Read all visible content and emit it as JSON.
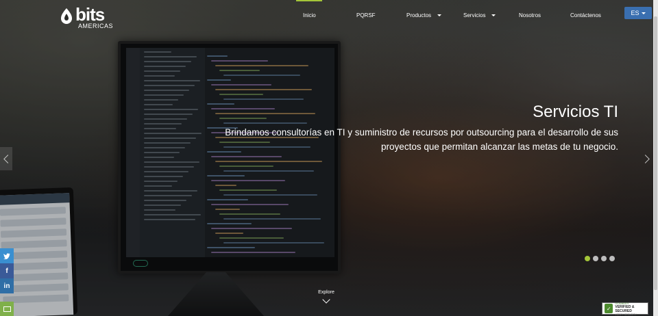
{
  "brand": {
    "name": "bits",
    "subtitle": "AMERICAS"
  },
  "nav": {
    "items": [
      {
        "label": "Inicio",
        "active": true
      },
      {
        "label": "PQRSF"
      },
      {
        "label": "Productos",
        "dropdown": true
      },
      {
        "label": "Servicios",
        "dropdown": true
      },
      {
        "label": "Nosotros"
      },
      {
        "label": "Contáctenos"
      }
    ],
    "language": "ES"
  },
  "slide": {
    "title": "Servicios TI",
    "description": "Brindamos consultorías en TI y suministro de recursos por outsourcing para el desarrollo de sus proyectos que permitan alcanzar las metas de tu negocio.",
    "total_slides": 4,
    "active_slide": 1
  },
  "explore": {
    "label": "Explore"
  },
  "social": {
    "twitter": "twitter-icon",
    "facebook": "facebook-icon",
    "linkedin": "linkedin-icon",
    "mail": "mail-icon"
  },
  "badge": {
    "top": "GODADDY",
    "main": "VERIFIED & SECURED",
    "sub": "VERIFY SECURITY"
  },
  "colors": {
    "accent": "#a4c639",
    "lang_button": "#3a6fb0"
  }
}
